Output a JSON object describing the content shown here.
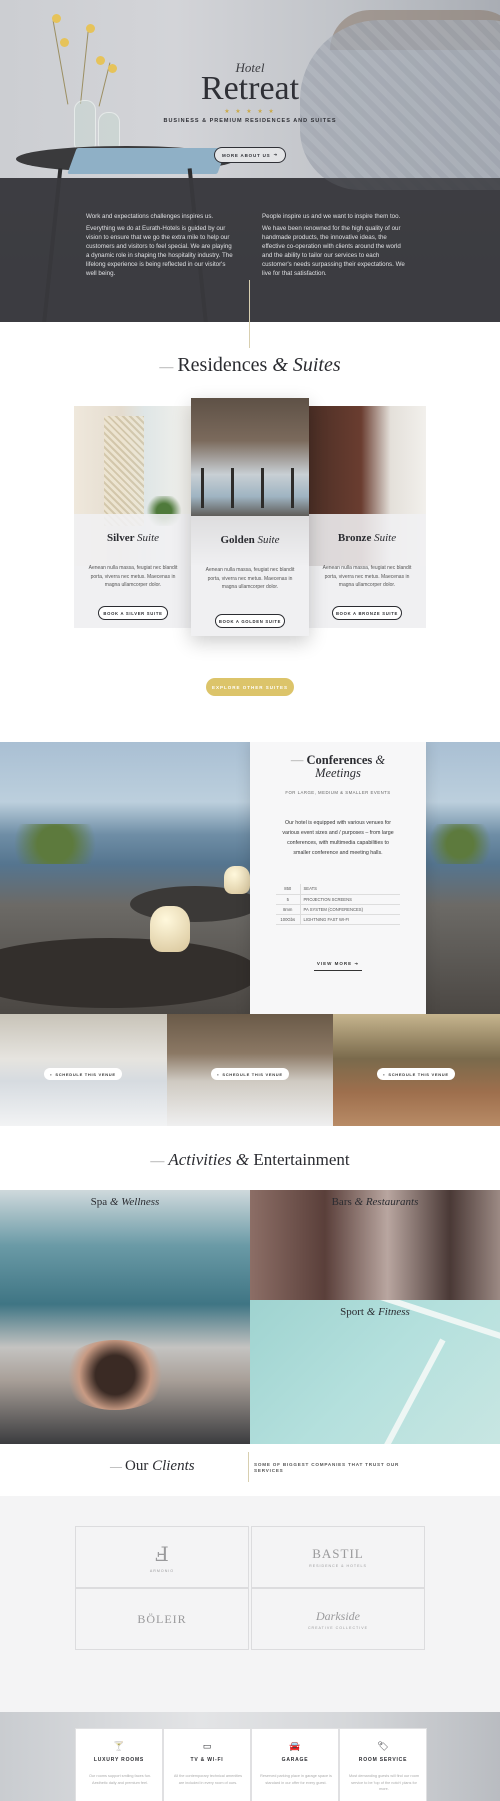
{
  "hero": {
    "pretitle": "Hotel",
    "title": "Retreat",
    "stars": "★ ★ ★ ★ ★",
    "subtitle": "BUSINESS & PREMIUM RESIDENCES AND SUITES",
    "button": "MORE ABOUT US",
    "col_left": [
      "Work and expectations challenges inspires us.",
      "Everything we do at Eurath-Hotels is guided by our vision to ensure that we go the extra mile to help our customers and visitors to feel special. We are playing a dynamic role in shaping the hospitality industry. The lifelong experience is being reflected in our visitor's well being."
    ],
    "col_right": [
      "People inspire us and we want to inspire them too.",
      "We have been renowned for the high quality of our handmade products, the innovative ideas, the effective co-operation with clients around the world and the ability to tailor our services to each customer's needs surpassing their expectations. We live for that satisfaction."
    ]
  },
  "residences": {
    "title_a": "Residences",
    "amp": "&",
    "title_b": "Suites",
    "suites": [
      {
        "name_a": "Silver",
        "name_b": "Suite",
        "text": "Aenean nulla massa, feugiat nec blandit porta, viverra nec metus. Maecenas in magna ullamcorper dolor.",
        "button": "BOOK A SILVER SUITE"
      },
      {
        "name_a": "Golden",
        "name_b": "Suite",
        "text": "Aenean nulla massa, feugiat nec blandit porta, viverra nec metus. Maecenas in magna ullamcorper dolor.",
        "button": "BOOK A GOLDEN SUITE"
      },
      {
        "name_a": "Bronze",
        "name_b": "Suite",
        "text": "Aenean nulla massa, feugiat nec blandit porta, viverra nec metus. Maecenas in magna ullamcorper dolor.",
        "button": "BOOK A BRONZE SUITE"
      }
    ],
    "explore": "EXPLORE OTHER SUITES"
  },
  "conferences": {
    "title_a": "Conferences",
    "amp": "&",
    "title_b": "Meetings",
    "subtitle": "FOR LARGE, MEDIUM & SMALLER EVENTS",
    "text": "Our hotel is equipped with various venues for various event sizes and / purposes – from large conferences, with multimedia capabilities to smaller conference and meeting halls.",
    "specs": [
      {
        "value": "850",
        "label": "SEATS"
      },
      {
        "value": "5",
        "label": "PROJECTION SCREENS"
      },
      {
        "value": "8mm",
        "label": "PA SYSTEM (CONFERENCES)"
      },
      {
        "value": "100Gbs",
        "label": "LIGHTNING FAST WI-FI"
      }
    ],
    "view_more": "VIEW MORE",
    "venue_button": "SCHEDULE THIS VENUE"
  },
  "activities": {
    "title_a": "Activities",
    "amp": "&",
    "title_b": "Entertainment",
    "tiles": [
      {
        "a": "Spa",
        "b": "Wellness"
      },
      {
        "a": "Bars",
        "b": "Restaurants"
      },
      {
        "a": "Sport",
        "b": "Fitness"
      }
    ]
  },
  "clients": {
    "title_a": "Our",
    "title_b": "Clients",
    "subtitle": "SOME OF BIGGEST COMPANIES THAT TRUST OUR SERVICES",
    "logos": [
      {
        "name": "ARMONIO",
        "mark": "Ⅎ"
      },
      {
        "name": "BASTIL",
        "sub": "RESIDENCE & HOTELS"
      },
      {
        "name": "BÖLEIR"
      },
      {
        "name": "Darkside",
        "sub": "CREATIVE COLLECTIVE"
      }
    ]
  },
  "services": [
    {
      "icon": "🍸",
      "title": "LUXURY ROOMS",
      "text": "Our rooms support smiling faces fun. Aesthetic daily and premium feel."
    },
    {
      "icon": "▭",
      "title": "TV & WI-FI",
      "text": "All the contemporary technical amenities are included in every room of ours."
    },
    {
      "icon": "🚘",
      "title": "GARAGE",
      "text": "Reserved parking place in garage space is standard in our offer for every guest."
    },
    {
      "icon": "🏷",
      "title": "ROOM SERVICE",
      "text": "Most demanding guests will find our room service to be 'top of the notch' plans for more."
    }
  ],
  "colors": {
    "accent": "#dcc46a",
    "dark": "#2b2c31"
  }
}
